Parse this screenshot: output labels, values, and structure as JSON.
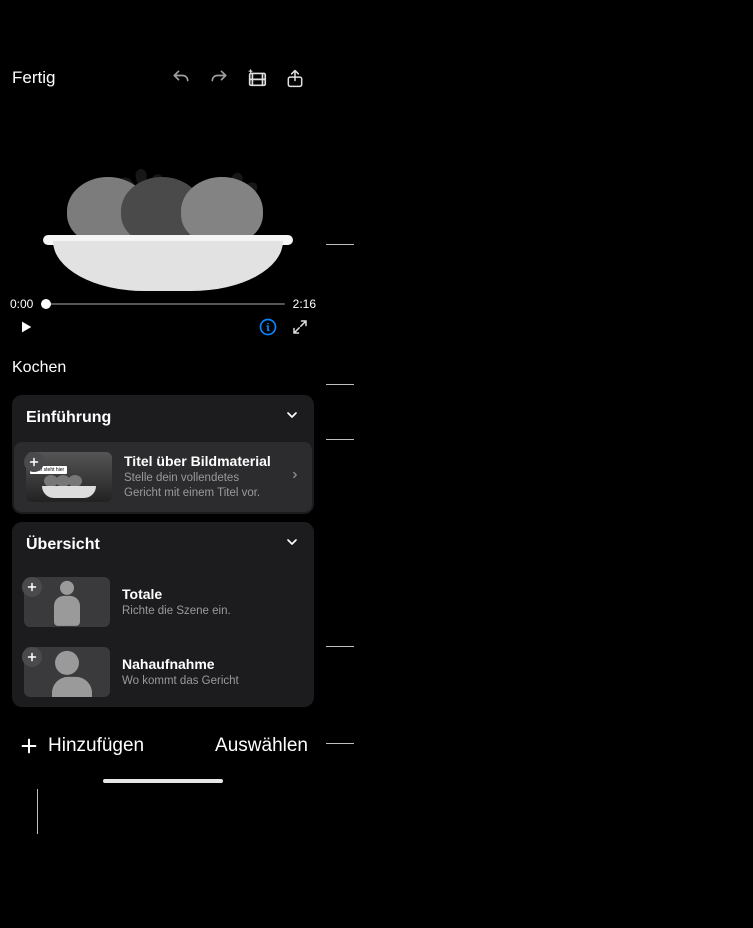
{
  "topbar": {
    "done": "Fertig"
  },
  "preview": {
    "current_time": "0:00",
    "total_time": "2:16"
  },
  "project_title": "Kochen",
  "sections": [
    {
      "title": "Einführung",
      "clips": [
        {
          "title": "Titel über Bildmaterial",
          "subtitle": "Stelle dein vollendetes Gericht mit einem Titel vor.",
          "thumb_overlay": "Titel steht hier"
        }
      ]
    },
    {
      "title": "Übersicht",
      "clips": [
        {
          "title": "Totale",
          "subtitle": "Richte die Szene ein."
        },
        {
          "title": "Nahaufnahme",
          "subtitle": "Wo kommt das Gericht"
        }
      ]
    }
  ],
  "bottom": {
    "add": "Hinzufügen",
    "select": "Auswählen"
  },
  "icons": {
    "undo": "undo-icon",
    "redo": "redo-icon",
    "magic": "magic-clip-icon",
    "share": "share-icon",
    "play": "play-icon",
    "info": "info-icon",
    "expand": "expand-icon",
    "chevron_down": "chevron-down-icon",
    "chevron_right": "chevron-right-icon",
    "plus": "plus-icon"
  }
}
